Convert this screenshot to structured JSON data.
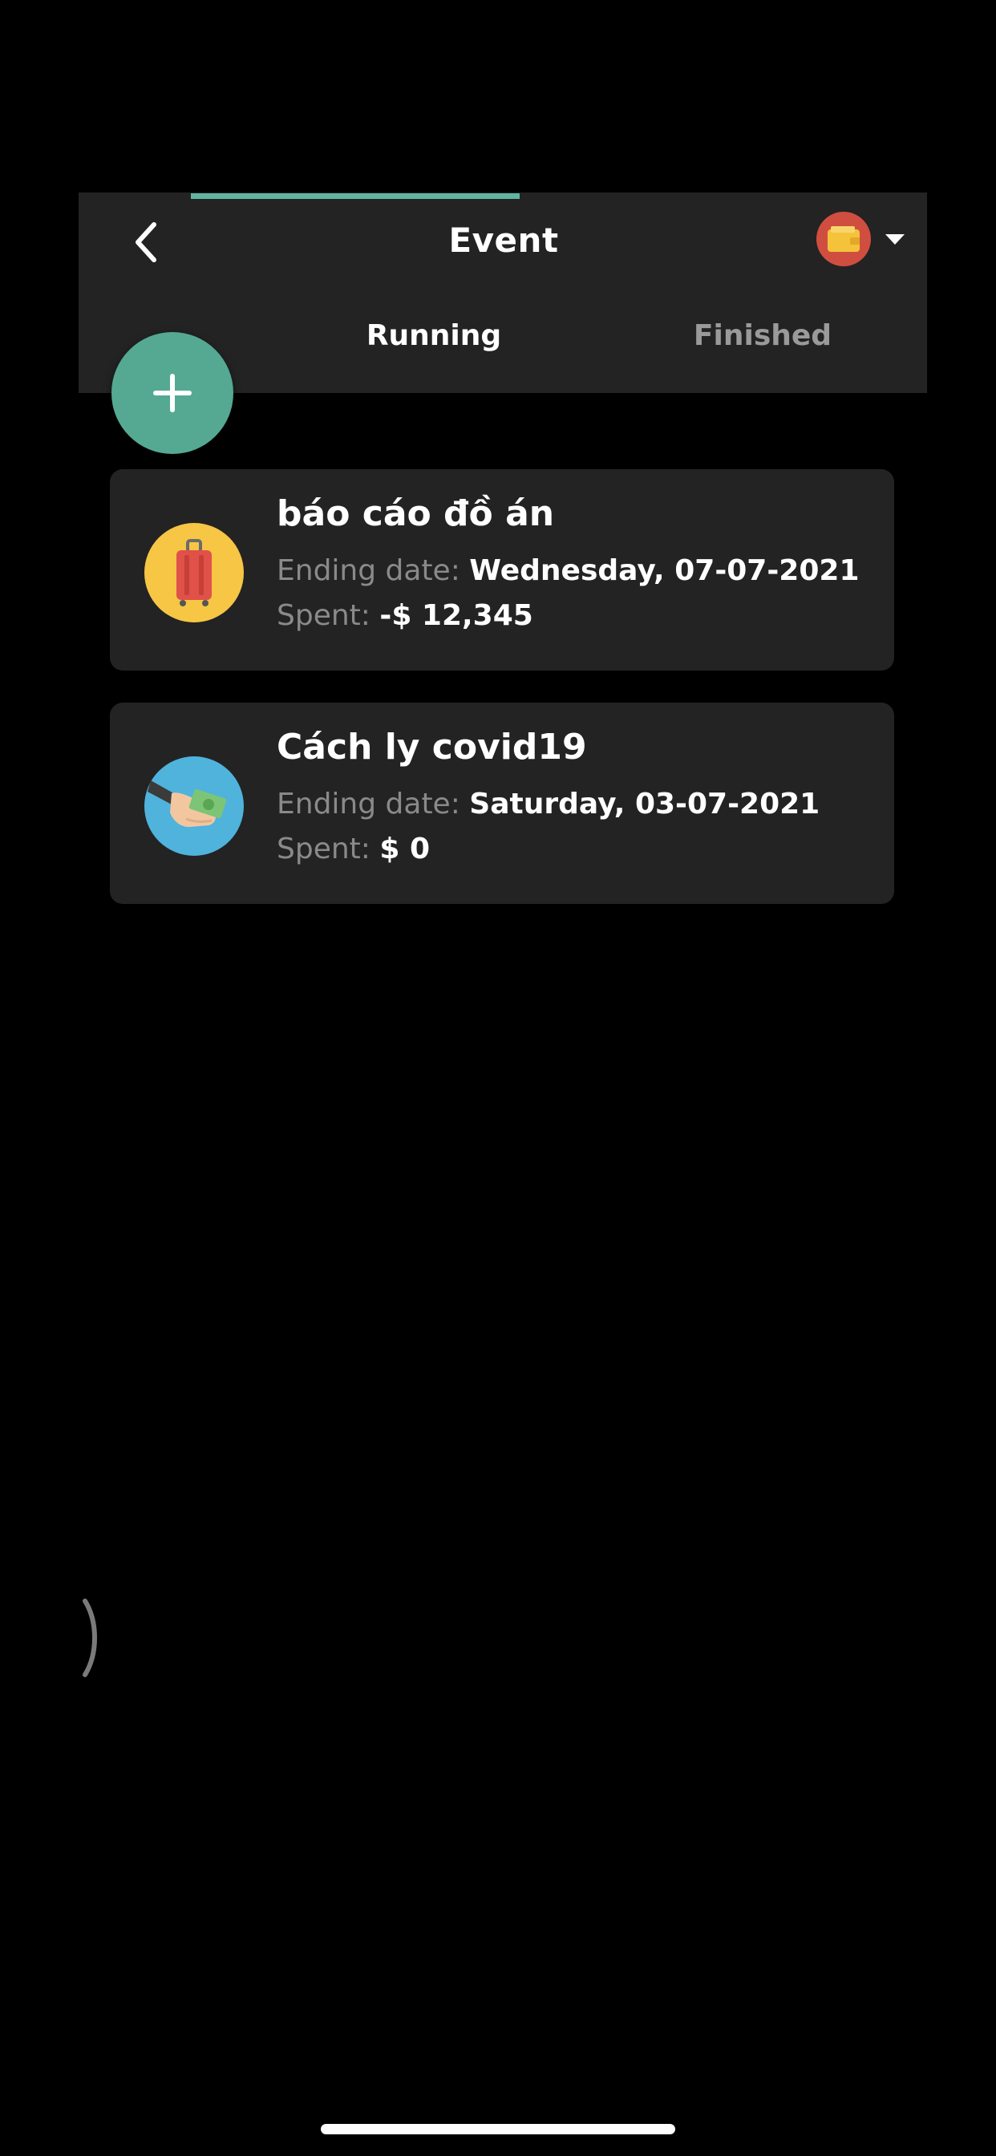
{
  "header": {
    "title": "Event",
    "back_icon": "chevron-left-icon",
    "wallet_icon": "wallet-icon",
    "dropdown_icon": "caret-down-icon"
  },
  "tabs": [
    {
      "label": "Running",
      "active": true
    },
    {
      "label": "Finished",
      "active": false
    }
  ],
  "add_button": {
    "icon": "plus-icon"
  },
  "events": [
    {
      "name": "báo cáo đồ án",
      "ending_label": "Ending date:",
      "ending_value": "Wednesday, 07-07-2021",
      "spent_label": "Spent:",
      "spent_value": "-$ 12,345",
      "icon": "luggage-icon"
    },
    {
      "name": "Cách ly covid19",
      "ending_label": "Ending date:",
      "ending_value": "Saturday, 03-07-2021",
      "spent_label": "Spent:",
      "spent_value": "$ 0",
      "icon": "hand-money-icon"
    }
  ],
  "colors": {
    "background": "#000000",
    "surface": "#222322",
    "accent": "#55a992",
    "tab_indicator": "#5fb5a0",
    "muted_text": "#8a8a8a"
  }
}
